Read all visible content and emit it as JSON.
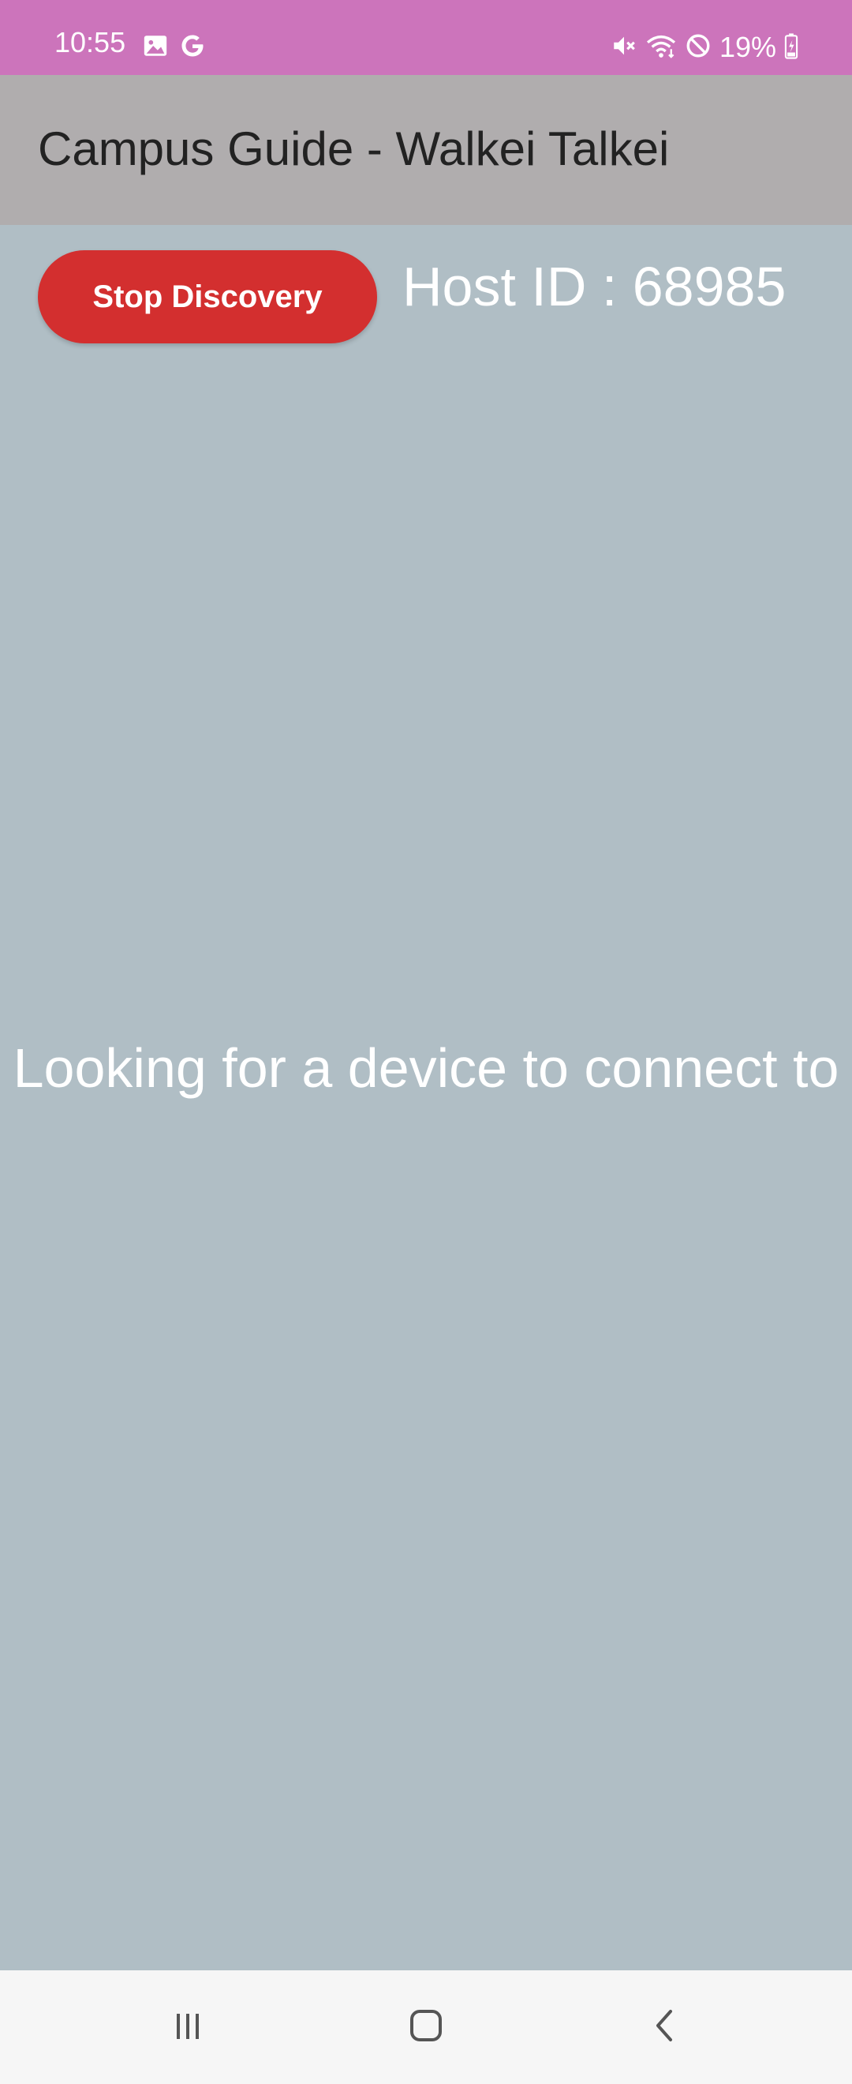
{
  "status_bar": {
    "time": "10:55",
    "battery": "19%",
    "left_icons": [
      "image-icon",
      "google-icon"
    ],
    "right_icons": [
      "mute-icon",
      "wifi-icon",
      "do-not-disturb-icon",
      "battery-charging-icon"
    ]
  },
  "app_bar": {
    "title": "Campus Guide - Walkei Talkei"
  },
  "main": {
    "stop_button_label": "Stop Discovery",
    "host_id": "Host ID : 68985",
    "status_message": "Looking for a device to connect to"
  },
  "nav_bar": {
    "buttons": [
      "recent-apps-icon",
      "home-icon",
      "back-icon"
    ]
  },
  "colors": {
    "status_bar": "#cc74bb",
    "app_bar": "#b0adae",
    "background": "#b0bec5",
    "accent_button": "#d32f2f"
  }
}
